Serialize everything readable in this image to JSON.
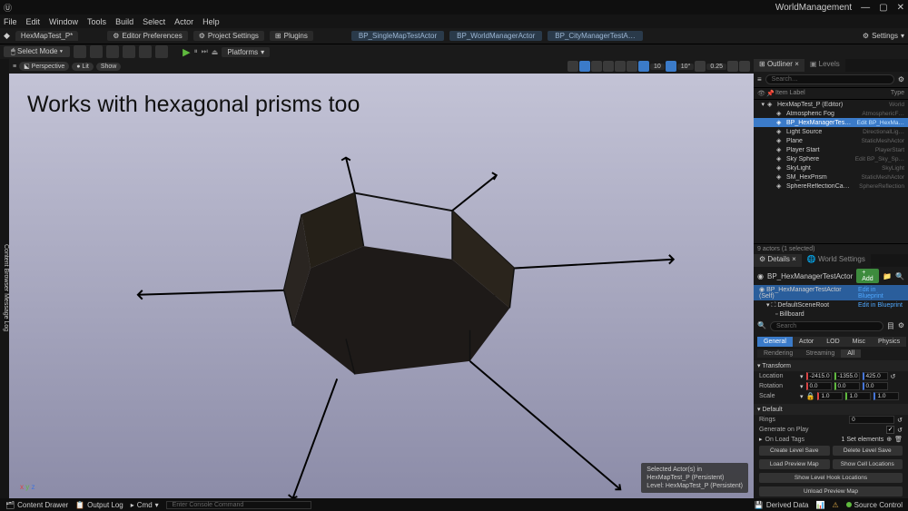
{
  "project_name": "WorldManagement",
  "menubar": [
    "File",
    "Edit",
    "Window",
    "Tools",
    "Build",
    "Select",
    "Actor",
    "Help"
  ],
  "asset_tab": "HexMapTest_P*",
  "toolbar": {
    "project_settings": "Project Settings",
    "editor_prefs": "Editor Preferences",
    "plugins": "Plugins",
    "settings": "Settings"
  },
  "bp_tabs": [
    "BP_SingleMapTestActor",
    "BP_WorldManagerActor",
    "BP_CityManagerTestA…"
  ],
  "secondary": {
    "select_mode": "Select Mode",
    "platforms": "Platforms"
  },
  "viewport": {
    "perspective": "Perspective",
    "lit": "Lit",
    "show": "Show",
    "nums": [
      "10",
      "10°",
      "0.25"
    ],
    "overlay_text": "Works with hexagonal prisms too",
    "footer_line1": "Selected Actor(s) in",
    "footer_line2": "HexMapTest_P (Persistent)",
    "footer_line3": "Level: HexMapTest_P (Persistent)"
  },
  "left_gutter": {
    "content_browser": "Content Browser",
    "message_log": "Message Log"
  },
  "outliner": {
    "tab1": "Outliner",
    "tab2": "Levels",
    "search_ph": "Search…",
    "col_label": "Item Label",
    "col_type": "Type",
    "rows": [
      {
        "label": "HexMapTest_P (Editor)",
        "type": "World",
        "indent": 0
      },
      {
        "label": "Atmospheric Fog",
        "type": "AtmosphericF…",
        "indent": 1
      },
      {
        "label": "BP_HexManagerTestActor",
        "type": "Edit BP_HexMa…",
        "indent": 1,
        "sel": true
      },
      {
        "label": "Light Source",
        "type": "DirectionalLig…",
        "indent": 1
      },
      {
        "label": "Plane",
        "type": "StaticMeshActor",
        "indent": 1
      },
      {
        "label": "Player Start",
        "type": "PlayerStart",
        "indent": 1
      },
      {
        "label": "Sky Sphere",
        "type": "Edit BP_Sky_Sp…",
        "indent": 1,
        "link": true
      },
      {
        "label": "SkyLight",
        "type": "SkyLight",
        "indent": 1
      },
      {
        "label": "SM_HexPrism",
        "type": "StaticMeshActor",
        "indent": 1
      },
      {
        "label": "SphereReflectionCapture",
        "type": "SphereReflection",
        "indent": 1
      }
    ],
    "footer": "9 actors (1 selected)"
  },
  "details": {
    "tab1": "Details",
    "tab2": "World Settings",
    "actor_name": "BP_HexManagerTestActor",
    "add": "+ Add",
    "self_row": "BP_HexManagerTestActor (Self)",
    "edit_bp": "Edit in Blueprint",
    "components": [
      {
        "name": "DefaultSceneRoot"
      },
      {
        "name": "Billboard"
      }
    ],
    "search_ph": "Search",
    "tabs": [
      "General",
      "Actor",
      "LOD",
      "Misc",
      "Physics"
    ],
    "sub_tabs": [
      "Rendering",
      "Streaming",
      "All"
    ],
    "transform_label": "Transform",
    "location": {
      "label": "Location",
      "x": "-2415.0",
      "y": "-1355.0",
      "z": "425.0"
    },
    "rotation": {
      "label": "Rotation",
      "x": "0.0",
      "y": "0.0",
      "z": "0.0"
    },
    "scale": {
      "label": "Scale",
      "x": "1.0",
      "y": "1.0",
      "z": "1.0"
    },
    "default_label": "Default",
    "rings_label": "Rings",
    "rings_value": "0",
    "gen_play_label": "Generate on Play",
    "load_tags_label": "On Load Tags",
    "load_tags_count": "1 Set elements",
    "buttons": [
      [
        "Create Level Save",
        "Delete Level Save"
      ],
      [
        "Load Preview Map",
        "Show Cell Locations"
      ],
      [
        "Show Level Hook Locations"
      ],
      [
        "Unload Preview Map"
      ]
    ]
  },
  "statusbar": {
    "content_drawer": "Content Drawer",
    "output_log": "Output Log",
    "cmd_label": "Cmd",
    "cmd_ph": "Enter Console Command",
    "derived": "Derived Data",
    "source": "Source Control"
  }
}
